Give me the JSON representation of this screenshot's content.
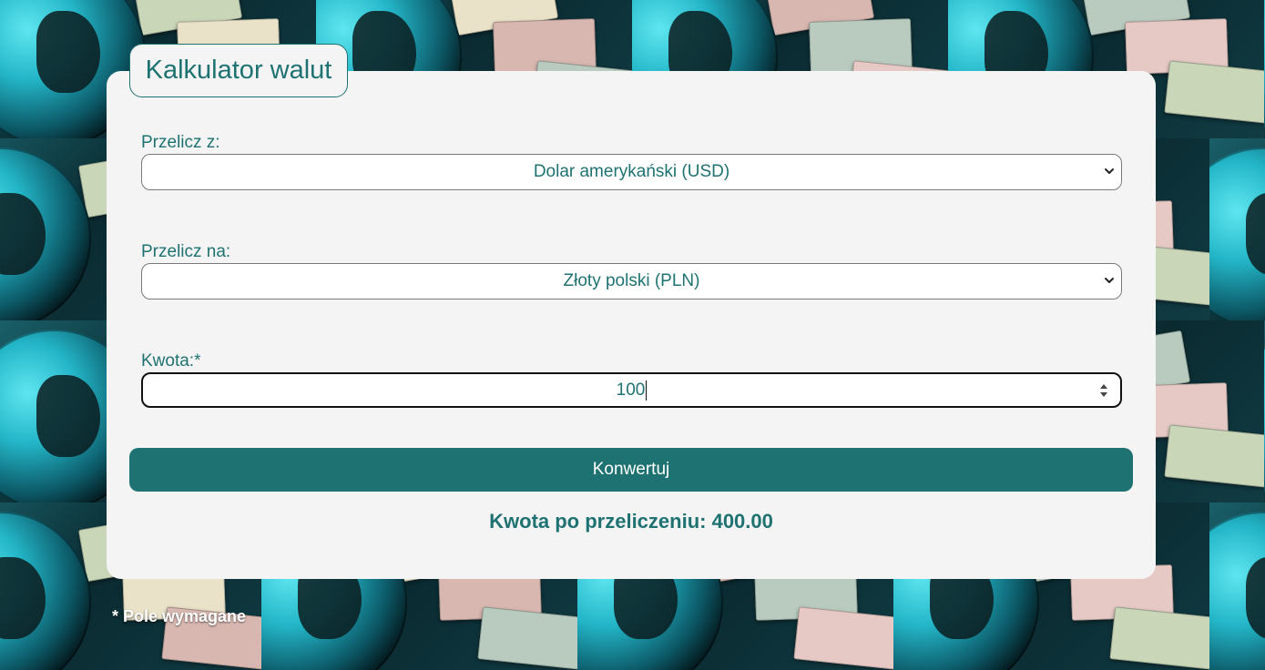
{
  "header": {
    "title": "Kalkulator walut"
  },
  "from": {
    "label": "Przelicz z:",
    "selected": "Dolar amerykański (USD)"
  },
  "to": {
    "label": "Przelicz na:",
    "selected": "Złoty polski (PLN)"
  },
  "amount": {
    "label": "Kwota:*",
    "value": "100"
  },
  "actions": {
    "convert_label": "Konwertuj"
  },
  "result": {
    "text": "Kwota po przeliczeniu: 400.00"
  },
  "footer": {
    "note": "* Pole wymagane"
  },
  "colors": {
    "accent": "#1f7272",
    "card": "#f4f4f4",
    "button_text": "#ffffff"
  },
  "icons": {
    "select_arrow": "chevron-down-icon",
    "stepper": "spin-arrows-icon"
  }
}
